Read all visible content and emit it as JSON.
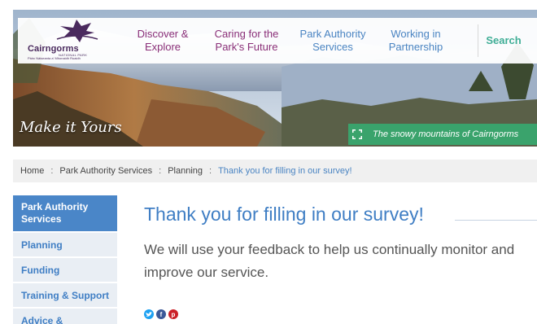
{
  "logo": {
    "title": "Cairngorms",
    "national_park": "NATIONAL PARK",
    "subtitle": "Pàirc Nàiseanta a' Mhonaidh Ruaidh"
  },
  "nav": {
    "items": [
      {
        "label": "Discover &\nExplore"
      },
      {
        "label": "Caring for the\nPark's Future"
      },
      {
        "label": "Park Authority\nServices"
      },
      {
        "label": "Working in\nPartnership"
      }
    ],
    "search_label": "Search"
  },
  "hero": {
    "tagline": "Make it Yours",
    "caption": "The snowy mountains of Cairngorms"
  },
  "breadcrumb": {
    "items": [
      "Home",
      "Park Authority Services",
      "Planning"
    ],
    "separator": ":",
    "current": "Thank you for filling in our survey!"
  },
  "sidebar": {
    "items": [
      {
        "label": "Park Authority Services"
      },
      {
        "label": "Planning"
      },
      {
        "label": "Funding"
      },
      {
        "label": "Training & Support"
      },
      {
        "label": "Advice &"
      }
    ]
  },
  "main": {
    "title": "Thank you for filling in our survey!",
    "body": "We will use your feedback to help us continually monitor and improve our service."
  },
  "social": {
    "icons": [
      "twitter-icon",
      "facebook-icon",
      "pinterest-icon"
    ],
    "colors": {
      "twitter": "#1da1f2",
      "facebook": "#3b5998",
      "pinterest": "#cb2027"
    }
  },
  "colors": {
    "accent_blue": "#4a86c8",
    "nav_purple": "#8a2f78",
    "search_green": "#3fae96",
    "caption_green": "#3aa36c"
  }
}
